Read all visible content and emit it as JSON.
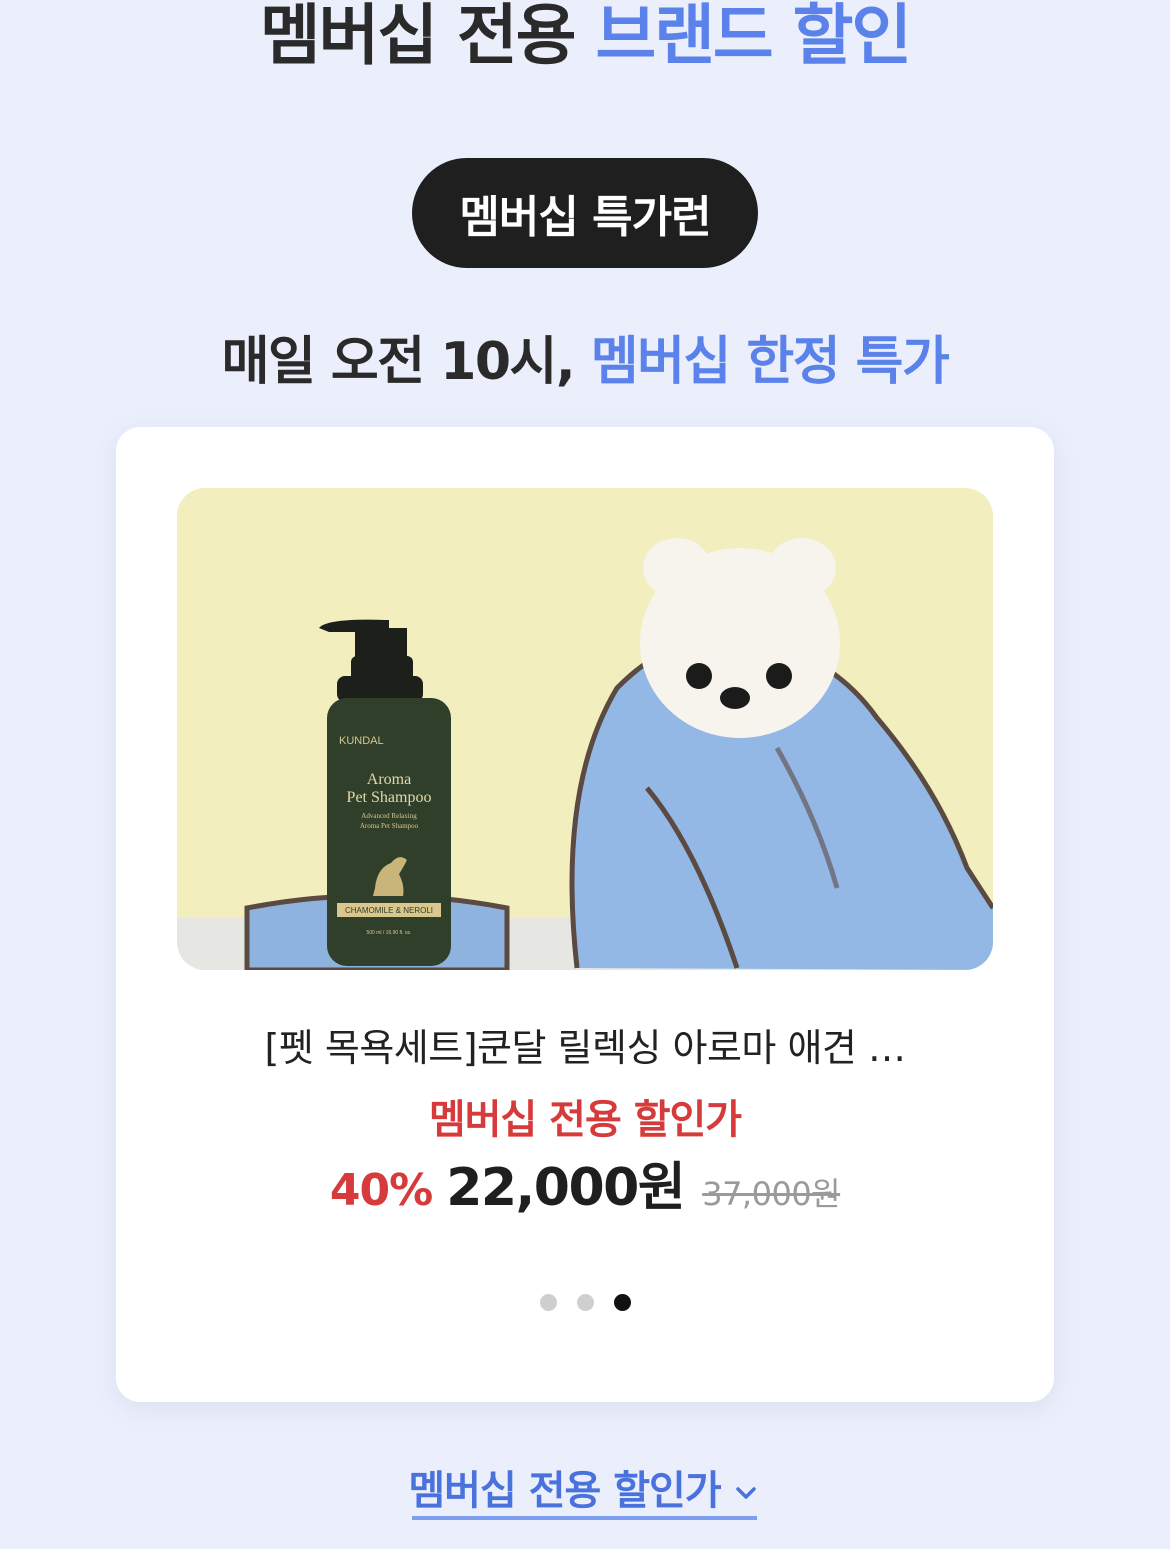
{
  "heading": {
    "prefix": "멤버십 전용",
    "highlight": "브랜드 할인"
  },
  "pill_label": "멤버십 특가런",
  "subheading": {
    "prefix": "매일 오전 10시,",
    "highlight": "멤버십 한정 특가"
  },
  "product": {
    "image": {
      "brand": "KUNDAL",
      "name_line1": "Aroma",
      "name_line2": "Pet Shampoo",
      "desc_line1": "Advanced Relaxing",
      "desc_line2": "Aroma Pet Shampoo",
      "scent": "CHAMOMILE & NEROLI",
      "volume": "500 ml / 16.90 fl. oz."
    },
    "title": "[펫 목욕세트]쿤달 릴렉싱 아로마 애견 …",
    "member_label": "멤버십 전용 할인가",
    "discount": "40%",
    "price": "22,000원",
    "original_price": "37,000원"
  },
  "carousel": {
    "total": 3,
    "active_index": 3
  },
  "footer": {
    "link_label": "멤버십 전용 할인가",
    "icon": "chevron-down-icon"
  },
  "colors": {
    "background": "#ebeffb",
    "accent_blue": "#5b82ea",
    "sale_red": "#d63a3a",
    "pill_dark": "#1f1f1f"
  }
}
